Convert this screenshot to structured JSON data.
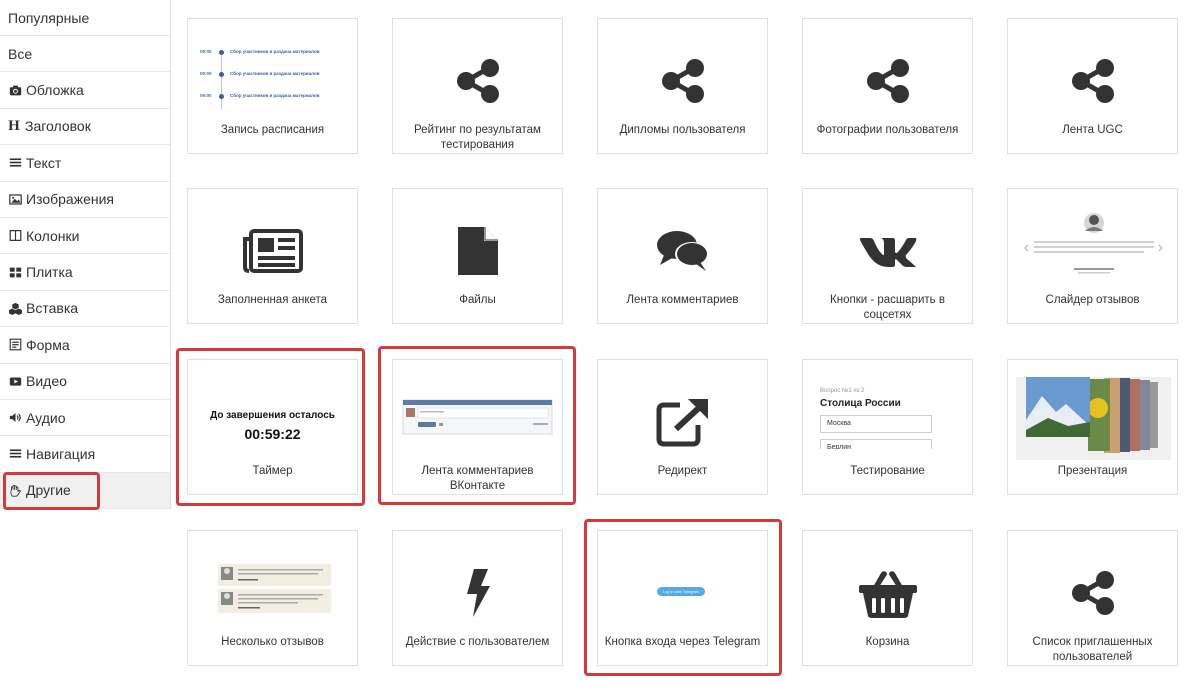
{
  "sidebar": {
    "items": [
      {
        "label": "Популярные",
        "icon": ""
      },
      {
        "label": "Все",
        "icon": ""
      },
      {
        "label": "Обложка",
        "icon": "camera-icon"
      },
      {
        "label": "Заголовок",
        "icon": "heading-icon"
      },
      {
        "label": "Текст",
        "icon": "lines-icon"
      },
      {
        "label": "Изображения",
        "icon": "picture-icon"
      },
      {
        "label": "Колонки",
        "icon": "columns-icon"
      },
      {
        "label": "Плитка",
        "icon": "tiles-icon"
      },
      {
        "label": "Вставка",
        "icon": "cubes-icon"
      },
      {
        "label": "Форма",
        "icon": "form-icon"
      },
      {
        "label": "Видео",
        "icon": "youtube-icon"
      },
      {
        "label": "Аудио",
        "icon": "volume-icon"
      },
      {
        "label": "Навигация",
        "icon": "menu-icon"
      },
      {
        "label": "Другие",
        "icon": "hand-icon"
      }
    ],
    "heading_glyph": "H",
    "active_index": 13
  },
  "cards": {
    "r1c1": {
      "label": "Запись расписания"
    },
    "r1c2": {
      "label": "Рейтинг по результатам тестирования"
    },
    "r1c3": {
      "label": "Дипломы пользователя"
    },
    "r1c4": {
      "label": "Фотографии пользователя"
    },
    "r1c5": {
      "label": "Лента UGC"
    },
    "r2c1": {
      "label": "Заполненная анкета"
    },
    "r2c2": {
      "label": "Файлы"
    },
    "r2c3": {
      "label": "Лента комментариев"
    },
    "r2c4": {
      "label": "Кнопки - расшарить в соцсетях"
    },
    "r2c5": {
      "label": "Слайдер отзывов"
    },
    "r3c1": {
      "label": "Таймер"
    },
    "r3c2": {
      "label": "Лента комментариев ВКонтакте"
    },
    "r3c3": {
      "label": "Редирект"
    },
    "r3c4": {
      "label": "Тестирование"
    },
    "r3c5": {
      "label": "Презентация"
    },
    "r4c1": {
      "label": "Несколько отзывов"
    },
    "r4c2": {
      "label": "Действие с пользователем"
    },
    "r4c3": {
      "label": "Кнопка входа через Telegram"
    },
    "r4c4": {
      "label": "Корзина"
    },
    "r4c5": {
      "label": "Список приглашенных пользователей"
    }
  },
  "previews": {
    "schedule": {
      "rows": [
        {
          "time": "09:00",
          "title": "Сбор участников и раздача материалов"
        },
        {
          "time": "09:00",
          "title": "Сбор участников и раздача материалов"
        },
        {
          "time": "09:00",
          "title": "Сбор участников и раздача материалов"
        }
      ]
    },
    "timer": {
      "title": "До завершения осталось",
      "value": "00:59:22"
    },
    "quiz": {
      "question": "Вопрос №1 из 2",
      "title": "Столица России",
      "options": [
        "Москва",
        "Берлин"
      ]
    },
    "telegram": {
      "button": "Log in with Telegram"
    }
  },
  "colors": {
    "highlight": "#d43a3a",
    "icon": "#333333",
    "telegram": "#54a9eb"
  }
}
